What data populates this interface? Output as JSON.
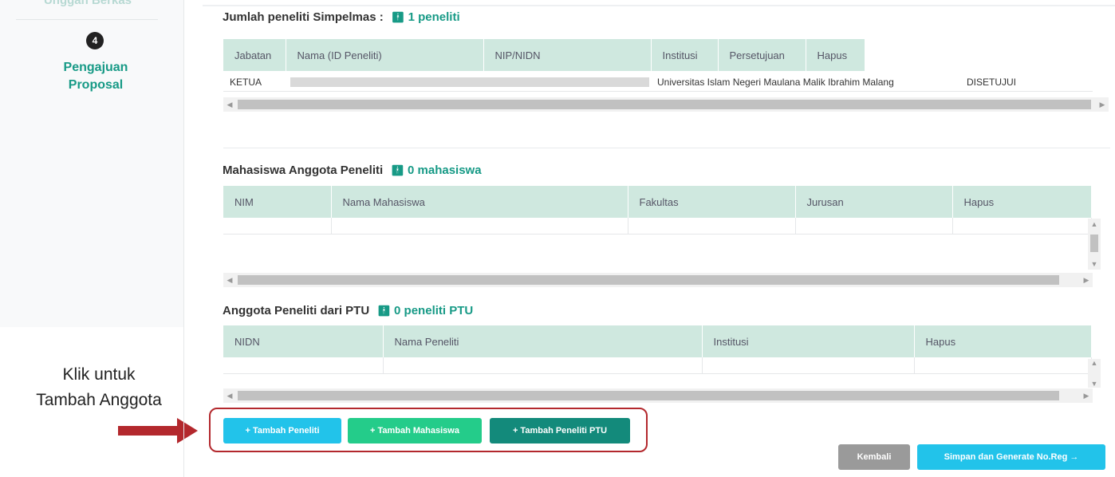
{
  "sidebar": {
    "prev_step_label": "Unggah Berkas",
    "step_number": "4",
    "step_label": "Pengajuan Proposal"
  },
  "callout": {
    "line1": "Klik untuk",
    "line2": "Tambah Anggota"
  },
  "peneliti": {
    "title": "Jumlah peneliti Simpelmas :",
    "count": "1 peneliti",
    "columns": [
      "Jabatan",
      "Nama (ID Peneliti)",
      "NIP/NIDN",
      "Institusi",
      "Persetujuan",
      "Hapus"
    ],
    "row": {
      "jabatan": "KETUA",
      "institusi": "Universitas Islam Negeri Maulana Malik Ibrahim Malang",
      "persetujuan": "DISETUJUI"
    }
  },
  "mahasiswa": {
    "title": "Mahasiswa Anggota Peneliti",
    "count": "0 mahasiswa",
    "columns": [
      "NIM",
      "Nama Mahasiswa",
      "Fakultas",
      "Jurusan",
      "Hapus"
    ]
  },
  "ptu": {
    "title": "Anggota Peneliti dari PTU",
    "count": "0 peneliti PTU",
    "columns": [
      "NIDN",
      "Nama Peneliti",
      "Institusi",
      "Hapus"
    ]
  },
  "buttons": {
    "tambah_peneliti": "+ Tambah Peneliti",
    "tambah_mahasiswa": "+ Tambah Mahasiswa",
    "tambah_ptu": "+ Tambah Peneliti PTU",
    "kembali": "Kembali",
    "simpan": "Simpan dan Generate No.Reg →"
  },
  "colors": {
    "accent": "#179a86",
    "header_bg": "#cfe8df",
    "btn_peneliti": "#22c3ea",
    "btn_mahasiswa": "#24cc8a",
    "btn_ptu": "#138a7b",
    "btn_kembali": "#9a9a9a",
    "btn_simpan": "#22c3ea",
    "callout_arrow": "#b3282d"
  }
}
